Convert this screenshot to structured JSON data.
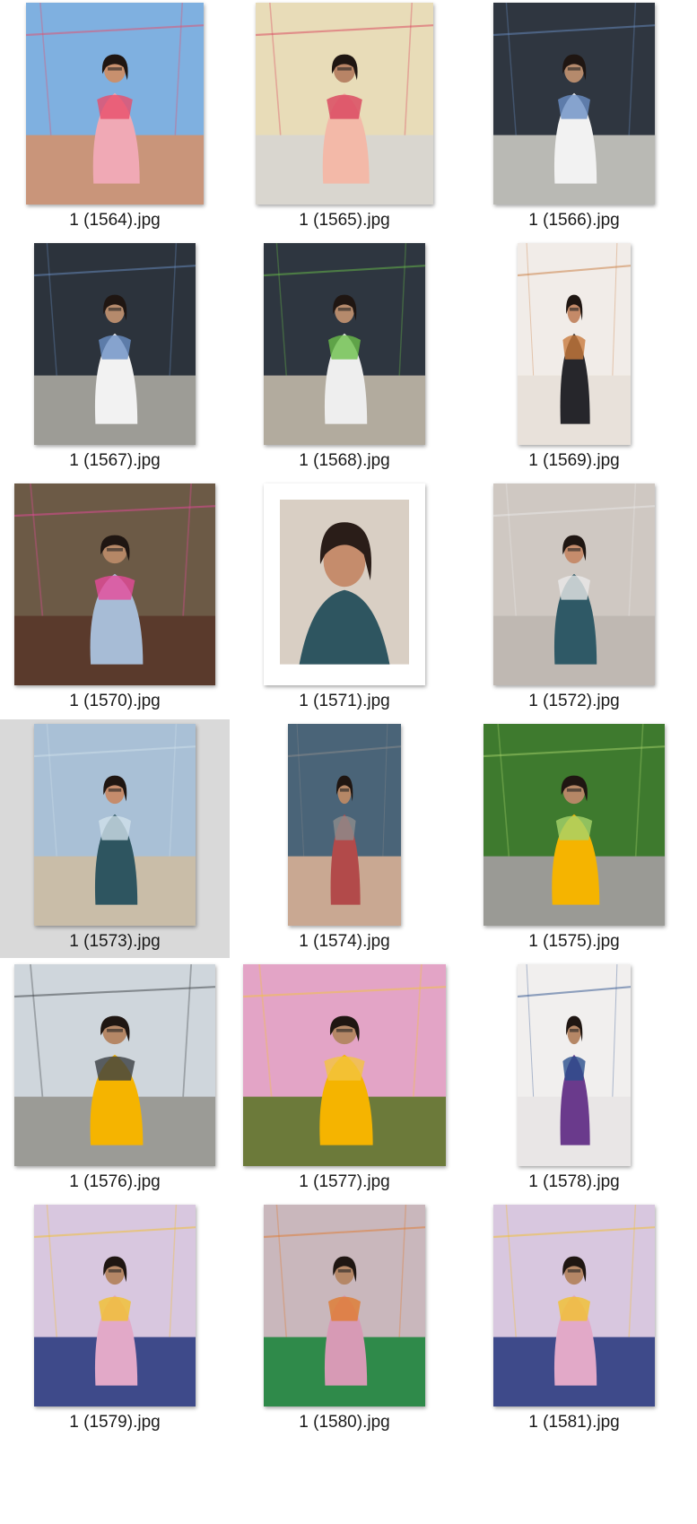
{
  "files": [
    {
      "name": "1 (1564).jpg",
      "selected": false,
      "orient": "portrait",
      "palette": {
        "bg": "#7fb0e0",
        "floor": "#c9957a",
        "outfit": "#f0a9b5",
        "accent": "#e84e6a",
        "skin": "#c8906e"
      }
    },
    {
      "name": "1 (1565).jpg",
      "selected": false,
      "orient": "landscape-tall",
      "palette": {
        "bg": "#e8dcb8",
        "floor": "#d9d6cf",
        "outfit": "#f3b9a8",
        "accent": "#d9425c",
        "skin": "#b88466"
      }
    },
    {
      "name": "1 (1566).jpg",
      "selected": false,
      "orient": "landscape-tall",
      "palette": {
        "bg": "#2f3640",
        "floor": "#b9b9b4",
        "outfit": "#f2f2f2",
        "accent": "#6a8fc4",
        "skin": "#b58a6c"
      }
    },
    {
      "name": "1 (1567).jpg",
      "selected": false,
      "orient": "portrait",
      "palette": {
        "bg": "#2c333c",
        "floor": "#9d9c96",
        "outfit": "#f2f2f2",
        "accent": "#6a8fc4",
        "skin": "#b58a6c"
      }
    },
    {
      "name": "1 (1568).jpg",
      "selected": false,
      "orient": "portrait",
      "palette": {
        "bg": "#2e3640",
        "floor": "#b2ab9e",
        "outfit": "#eeeeee",
        "accent": "#6bbf4a",
        "skin": "#b58a6c"
      }
    },
    {
      "name": "1 (1569).jpg",
      "selected": false,
      "orient": "narrow",
      "palette": {
        "bg": "#f1ece8",
        "floor": "#e8e1da",
        "outfit": "#26262b",
        "accent": "#c97a3c",
        "skin": "#c48a68"
      }
    },
    {
      "name": "1 (1570).jpg",
      "selected": false,
      "orient": "portrait",
      "palette": {
        "bg": "#6c5a46",
        "floor": "#5a3a2c",
        "outfit": "#a7bcd6",
        "accent": "#e64a9a",
        "skin": "#b58766"
      }
    },
    {
      "name": "1 (1571).jpg",
      "selected": false,
      "orient": "framed",
      "palette": {
        "bg": "#d9cfc4",
        "floor": "#ffffff",
        "outfit": "#2e5560",
        "accent": "#e5e5e5",
        "skin": "#c58c6c"
      }
    },
    {
      "name": "1 (1572).jpg",
      "selected": false,
      "orient": "landscape-tall",
      "palette": {
        "bg": "#cfc8c2",
        "floor": "#bfb8b2",
        "outfit": "#2f5966",
        "accent": "#e9e9e9",
        "skin": "#c58c6c"
      }
    },
    {
      "name": "1 (1573).jpg",
      "selected": true,
      "orient": "portrait",
      "palette": {
        "bg": "#a9c0d6",
        "floor": "#c9bda8",
        "outfit": "#2e5560",
        "accent": "#cfe0ea",
        "skin": "#c58c6c"
      }
    },
    {
      "name": "1 (1574).jpg",
      "selected": false,
      "orient": "narrow",
      "palette": {
        "bg": "#4a6478",
        "floor": "#c9a892",
        "outfit": "#b24a4a",
        "accent": "#8c8c8c",
        "skin": "#b58766"
      }
    },
    {
      "name": "1 (1575).jpg",
      "selected": false,
      "orient": "landscape-tall",
      "palette": {
        "bg": "#3e7a2e",
        "floor": "#9a9a95",
        "outfit": "#f5b400",
        "accent": "#a6d36a",
        "skin": "#b58766"
      }
    },
    {
      "name": "1 (1576).jpg",
      "selected": false,
      "orient": "portrait",
      "palette": {
        "bg": "#cfd6dc",
        "floor": "#9b9b96",
        "outfit": "#f5b400",
        "accent": "#3a3e42",
        "skin": "#b58766"
      }
    },
    {
      "name": "1 (1577).jpg",
      "selected": false,
      "orient": "landscape-tall",
      "palette": {
        "bg": "#e3a4c6",
        "floor": "#6c7a3a",
        "outfit": "#f5b400",
        "accent": "#f2c440",
        "skin": "#b58766"
      }
    },
    {
      "name": "1 (1578).jpg",
      "selected": false,
      "orient": "narrow",
      "palette": {
        "bg": "#f1efee",
        "floor": "#e9e6e6",
        "outfit": "#6a3a8c",
        "accent": "#2a4f8c",
        "skin": "#b58766"
      }
    },
    {
      "name": "1 (1579).jpg",
      "selected": false,
      "orient": "portrait",
      "palette": {
        "bg": "#d8c7df",
        "floor": "#3e4a8a",
        "outfit": "#e2a9c8",
        "accent": "#f2c12e",
        "skin": "#b58766"
      }
    },
    {
      "name": "1 (1580).jpg",
      "selected": false,
      "orient": "portrait",
      "palette": {
        "bg": "#c9b7bc",
        "floor": "#2f8a4a",
        "outfit": "#d79ab5",
        "accent": "#e07a30",
        "skin": "#b58766"
      }
    },
    {
      "name": "1 (1581).jpg",
      "selected": false,
      "orient": "portrait",
      "palette": {
        "bg": "#d8c7df",
        "floor": "#3e4a8a",
        "outfit": "#e2a9c8",
        "accent": "#f2c12e",
        "skin": "#b58766"
      }
    }
  ]
}
